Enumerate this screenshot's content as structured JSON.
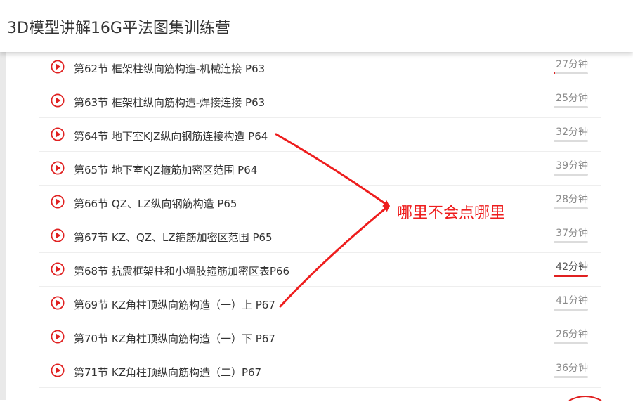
{
  "header": {
    "title": "3D模型讲解16G平法图集训练营"
  },
  "annotation": {
    "text": "哪里不会点哪里",
    "color": "#ee1d1d"
  },
  "accent_color": "#e02020",
  "icons": {
    "play": "play-circle-icon"
  },
  "lessons": [
    {
      "label": "第62节 框架柱纵向筋构造-机械连接 P63",
      "duration": "27分钟",
      "progress": 0.04
    },
    {
      "label": "第63节 框架柱纵向筋构造-焊接连接 P63",
      "duration": "25分钟",
      "progress": 0
    },
    {
      "label": "第64节 地下室KJZ纵向钢筋连接构造 P64",
      "duration": "32分钟",
      "progress": 0
    },
    {
      "label": "第65节 地下室KJZ箍筋加密区范围 P64",
      "duration": "39分钟",
      "progress": 0
    },
    {
      "label": "第66节 QZ、LZ纵向钢筋构造 P65",
      "duration": "28分钟",
      "progress": 0
    },
    {
      "label": "第67节 KZ、QZ、LZ箍筋加密区范围 P65",
      "duration": "37分钟",
      "progress": 0
    },
    {
      "label": "第68节 抗震框架柱和小墙肢箍筋加密区表P66",
      "duration": "42分钟",
      "progress": 1,
      "active": true
    },
    {
      "label": "第69节 KZ角柱顶纵向筋构造（一）上 P67",
      "duration": "41分钟",
      "progress": 0
    },
    {
      "label": "第70节 KZ角柱顶纵向筋构造（一）下 P67",
      "duration": "26分钟",
      "progress": 0
    },
    {
      "label": "第71节 KZ角柱顶纵向筋构造（二）P67",
      "duration": "36分钟",
      "progress": 0
    }
  ]
}
